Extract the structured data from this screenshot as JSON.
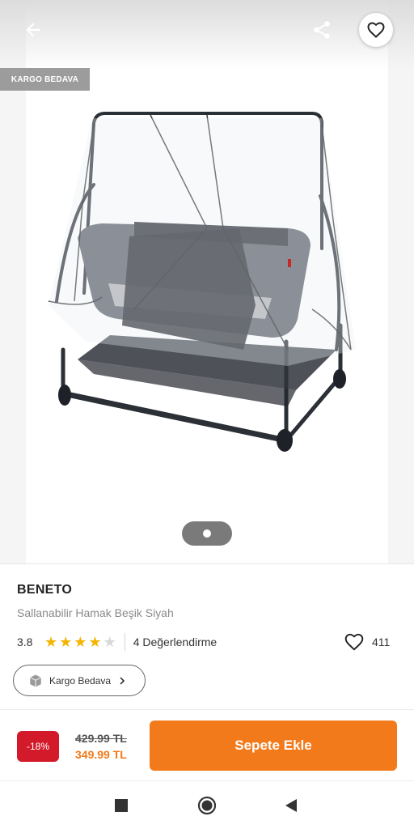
{
  "header": {
    "back_icon": "arrow-left-icon",
    "share_icon": "share-icon",
    "favorite_icon": "heart-outline-icon"
  },
  "gallery": {
    "badge": "KARGO BEDAVA",
    "image": "baby-cradle-with-mosquito-net",
    "page_indicator": "1 of 1"
  },
  "product": {
    "brand": "BENETO",
    "name": "Sallanabilir Hamak Beşik Siyah",
    "rating": "3.8",
    "rating_stars_filled": 4,
    "rating_stars_total": 5,
    "reviews": "4 Değerlendirme",
    "favorites": "411"
  },
  "cargo_chip": {
    "label": "Kargo Bedava",
    "icon": "box-icon"
  },
  "purchase": {
    "discount": "-18%",
    "old_price": "429.99 TL",
    "new_price": "349.99 TL",
    "add_to_cart": "Sepete Ekle"
  },
  "colors": {
    "accent": "#f27a1a",
    "discount": "#d31a2b",
    "star": "#f5b400"
  },
  "system_nav": [
    "recents",
    "home",
    "back"
  ]
}
